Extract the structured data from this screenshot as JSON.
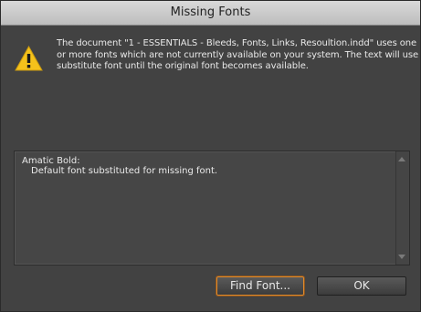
{
  "dialog": {
    "title": "Missing Fonts",
    "message_lines": [
      "The document \"1 - ESSENTIALS - Bleeds, Fonts, Links, Resoultion.indd\" uses one",
      "or more fonts which are not currently available on your system. The text will use a",
      "substitute font until the original font becomes available."
    ],
    "missing_fonts": [
      {
        "name": "Amatic Bold:",
        "detail": "Default font substituted for missing font."
      }
    ],
    "buttons": {
      "find_font": "Find Font...",
      "ok": "OK"
    }
  },
  "icons": {
    "warning": "warning-triangle-icon"
  },
  "colors": {
    "warning_yellow": "#f5c21b",
    "focus_orange": "#e08a2c"
  }
}
